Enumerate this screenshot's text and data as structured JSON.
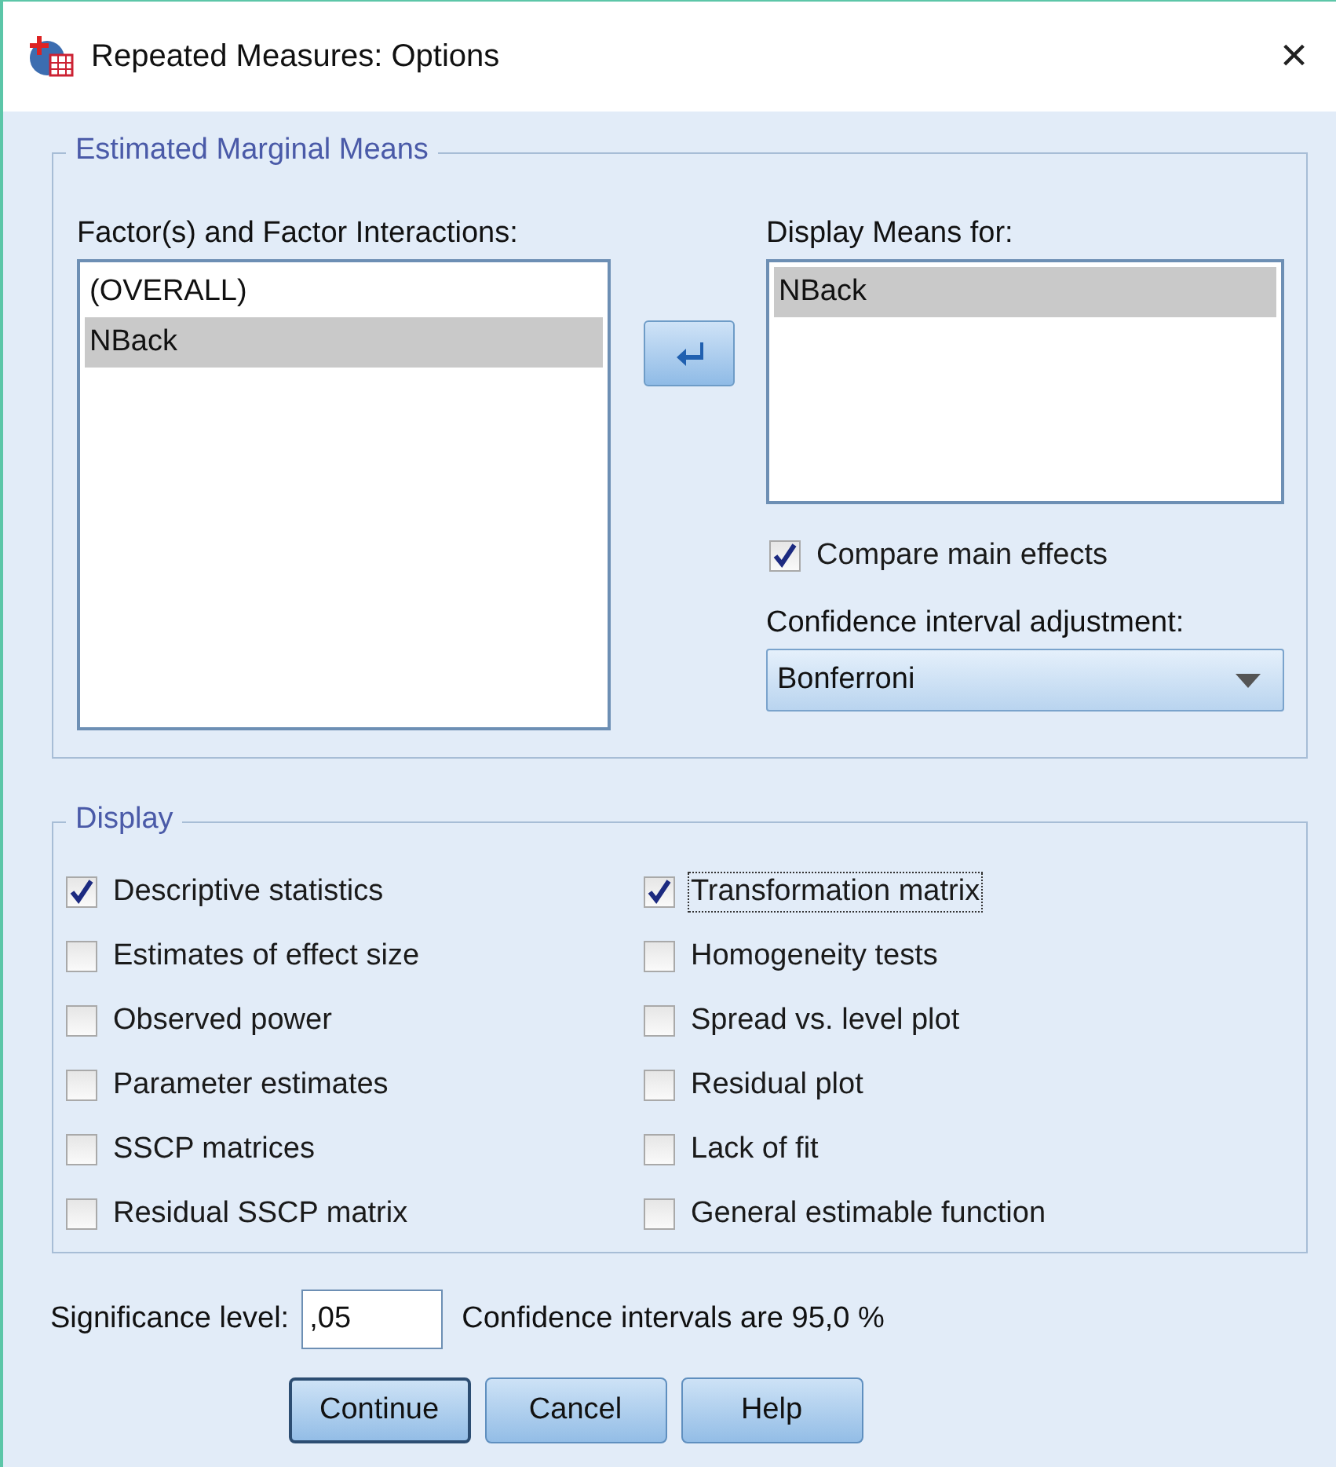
{
  "window": {
    "title": "Repeated Measures: Options",
    "close": "×"
  },
  "estimated_marginal_means": {
    "title": "Estimated Marginal Means",
    "factors": {
      "label": "Factor(s) and Factor Interactions:",
      "items": [
        {
          "text": "(OVERALL)",
          "selected": false
        },
        {
          "text": "NBack",
          "selected": true
        }
      ]
    },
    "display_means": {
      "label": "Display Means for:",
      "items": [
        {
          "text": "NBack",
          "selected": true
        }
      ]
    },
    "compare_main_effects": {
      "label": "Compare main effects",
      "checked": true
    },
    "adjustment": {
      "label": "Confidence interval adjustment:",
      "value": "Bonferroni"
    }
  },
  "display": {
    "title": "Display",
    "options": [
      {
        "label": "Descriptive statistics",
        "checked": true,
        "focused": false
      },
      {
        "label": "Transformation matrix",
        "checked": true,
        "focused": true
      },
      {
        "label": "Estimates of effect size",
        "checked": false,
        "focused": false
      },
      {
        "label": "Homogeneity tests",
        "checked": false,
        "focused": false
      },
      {
        "label": "Observed power",
        "checked": false,
        "focused": false
      },
      {
        "label": "Spread vs. level plot",
        "checked": false,
        "focused": false
      },
      {
        "label": "Parameter estimates",
        "checked": false,
        "focused": false
      },
      {
        "label": "Residual plot",
        "checked": false,
        "focused": false
      },
      {
        "label": "SSCP matrices",
        "checked": false,
        "focused": false
      },
      {
        "label": "Lack of fit",
        "checked": false,
        "focused": false
      },
      {
        "label": "Residual SSCP matrix",
        "checked": false,
        "focused": false
      },
      {
        "label": "General estimable function",
        "checked": false,
        "focused": false
      }
    ]
  },
  "significance": {
    "label": "Significance level:",
    "value": ",05",
    "note": "Confidence intervals are 95,0 %"
  },
  "buttons": [
    {
      "label": "Continue",
      "default": true
    },
    {
      "label": "Cancel",
      "default": false
    },
    {
      "label": "Help",
      "default": false
    }
  ]
}
